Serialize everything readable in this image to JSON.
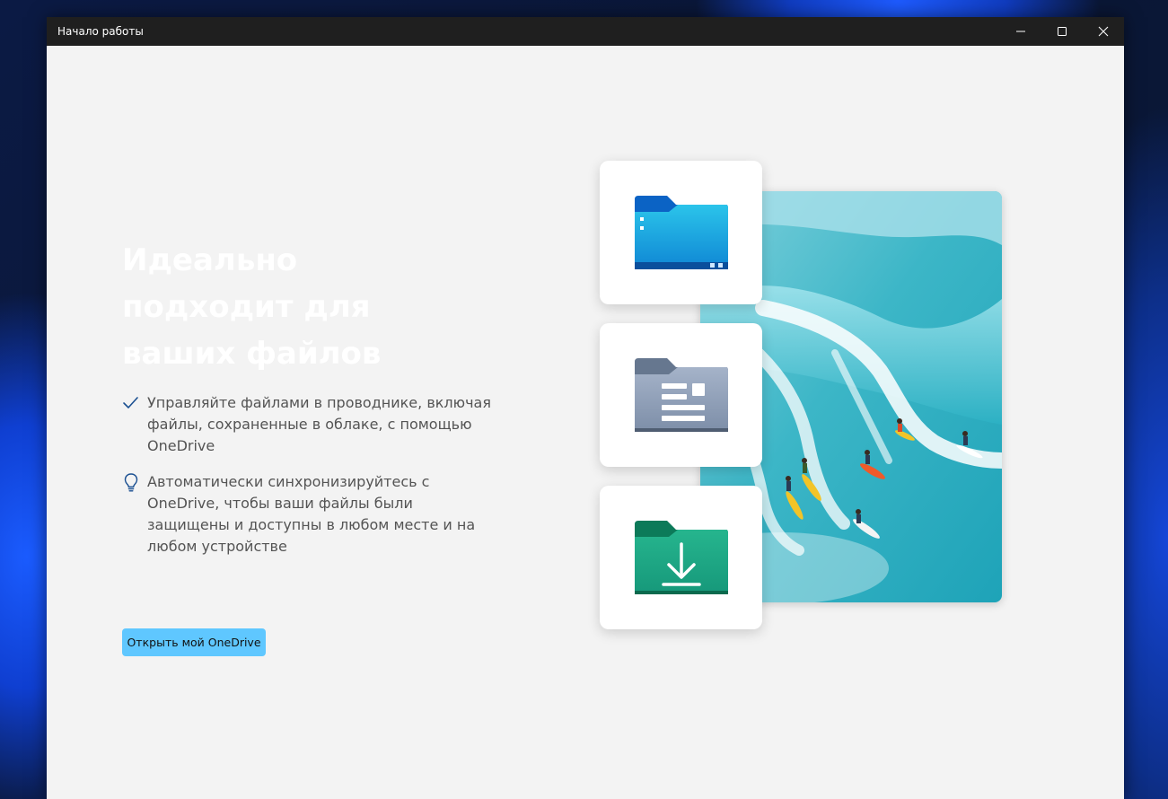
{
  "window": {
    "title": "Начало работы",
    "controls": {
      "minimize_icon": "minimize-icon",
      "maximize_icon": "maximize-icon",
      "close_icon": "close-icon"
    }
  },
  "content": {
    "headline": "Идеально подходит для ваших файлов",
    "features": [
      {
        "icon": "checkmark-icon",
        "text": "Управляйте файлами в проводнике, включая файлы, сохраненные в облаке, с помощью OneDrive"
      },
      {
        "icon": "lightbulb-icon",
        "text": "Автоматически синхронизируйтесь с OneDrive, чтобы ваши файлы были защищены и доступны в любом месте и на любом устройстве"
      }
    ],
    "open_button_label": "Открыть мой OneDrive"
  },
  "illustration": {
    "cards": [
      "folder-icon",
      "documents-folder-icon",
      "downloads-folder-icon"
    ],
    "photo": "surfers-wave-photo"
  },
  "colors": {
    "accent_button": "#5fc7ff",
    "window_background": "#f3f3f3",
    "titlebar": "#1f1f1f",
    "feature_icon": "#1a4f91"
  }
}
